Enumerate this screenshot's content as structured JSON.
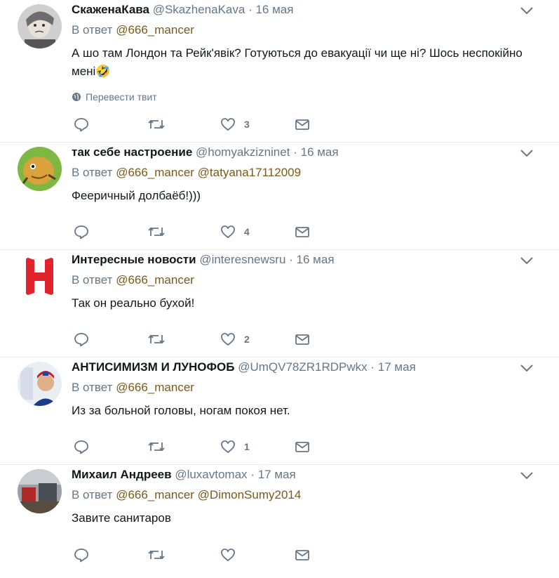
{
  "tweets": [
    {
      "fullname": "СкаженаКава",
      "username": "@SkazhenaKava",
      "dot": "·",
      "time": "16 мая",
      "reply_label": "В ответ",
      "mentions": "@666_mancer",
      "text": "А шо там Лондон та Рейк'явік? Готуються до евакуації чи ще ні? Шось неспокійно мені🤣",
      "translate": "Перевести твит",
      "likes": "3"
    },
    {
      "fullname": "так себе настроение",
      "username": "@homyakzizninet",
      "dot": "·",
      "time": "16 мая",
      "reply_label": "В ответ",
      "mentions": "@666_mancer @tatyana17112009",
      "text": "Фееричный долбаёб!)))",
      "likes": "4"
    },
    {
      "fullname": "Интересные новости",
      "username": "@interesnewsru",
      "dot": "·",
      "time": "16 мая",
      "reply_label": "В ответ",
      "mentions": "@666_mancer",
      "text": "Так он реально бухой!",
      "likes": "2"
    },
    {
      "fullname": "АНТИСИМИЗМ И ЛУНОФОБ",
      "username": "@UmQV78ZR1RDPwkx",
      "dot": "·",
      "time": "17 мая",
      "reply_label": "В ответ",
      "mentions": "@666_mancer",
      "text": "Из за больной головы, ногам покоя нет.",
      "likes": "1"
    },
    {
      "fullname": "Михаил Андреев",
      "username": "@luxavtomax",
      "dot": "·",
      "time": "17 мая",
      "reply_label": "В ответ",
      "mentions": "@666_mancer @DimonSumy2014",
      "text": "Завите санитаров",
      "likes": ""
    }
  ],
  "colors": {
    "text": "#14171a",
    "secondary": "#657786",
    "mention": "#7a5a1a",
    "divider": "#e6ecf0",
    "icon": "#657786"
  },
  "icons": [
    "chevron-down-icon",
    "globe-icon",
    "reply-icon",
    "retweet-icon",
    "like-icon",
    "direct-message-icon"
  ]
}
